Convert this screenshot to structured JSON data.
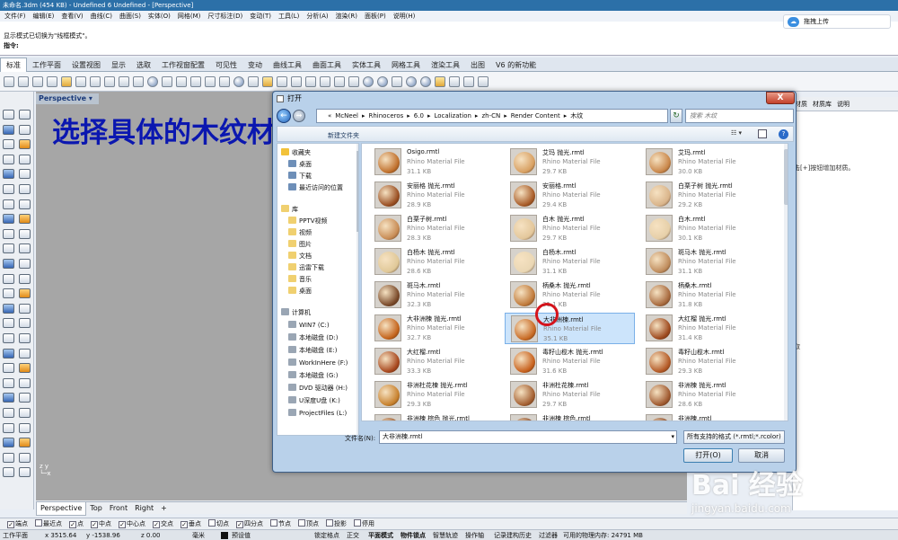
{
  "window": {
    "title": "未命名.3dm (454 KB) - Undefined 6 Undefined - [Perspective]"
  },
  "menu": [
    "文件(F)",
    "编辑(E)",
    "查看(V)",
    "曲线(C)",
    "曲面(S)",
    "实体(O)",
    "网格(M)",
    "尺寸标注(D)",
    "变动(T)",
    "工具(L)",
    "分析(A)",
    "渲染(R)",
    "面板(P)",
    "说明(H)"
  ],
  "cloud_button": {
    "label": "拖拽上传"
  },
  "command": {
    "line1": "显示模式已切换为\"线框模式\"。",
    "prompt": "指令:"
  },
  "tabs": [
    "标准",
    "工作平面",
    "设置视图",
    "显示",
    "选取",
    "工作视窗配置",
    "可见性",
    "变动",
    "曲线工具",
    "曲面工具",
    "实体工具",
    "网格工具",
    "渲染工具",
    "出图",
    "V6 的新功能"
  ],
  "viewport": {
    "label": "Perspective ▾",
    "tabs": [
      "Perspective",
      "Top",
      "Front",
      "Right",
      "+"
    ]
  },
  "caption": "选择具体的木纹材质",
  "right_panel": {
    "tabs": [
      "材质",
      "材质库",
      "说明"
    ],
    "hint": "击[+]按钮增加材质。",
    "line2": "取"
  },
  "dialog": {
    "title": "打开",
    "back": "←",
    "forward": "→",
    "close": "X",
    "breadcrumb": [
      "«",
      "McNeel",
      "▸",
      "Rhinoceros",
      "▸",
      "6.0",
      "▸",
      "Localization",
      "▸",
      "zh-CN",
      "▸",
      "Render Content",
      "▸",
      "木纹"
    ],
    "search_placeholder": "搜索 木纹",
    "new_folder": "新建文件夹",
    "nav": {
      "favorites_header": "收藏夹",
      "favorites": [
        "桌面",
        "下载",
        "最近访问的位置"
      ],
      "library_header": "库",
      "libraries": [
        "PPTV视频",
        "视频",
        "图片",
        "文档",
        "迅雷下载",
        "音乐",
        "桌面"
      ],
      "computer_header": "计算机",
      "drives": [
        "WIN7 (C:)",
        "本地磁盘 (D:)",
        "本地磁盘 (E:)",
        "WorkInHere (F:)",
        "本地磁盘 (G:)",
        "DVD 驱动器 (H:)",
        "U深度U盘 (K:)",
        "ProjectFiles (L:)"
      ]
    },
    "files": [
      {
        "name": "Osigo.rmtl",
        "type": "Rhino Material File",
        "size": "31.1 KB"
      },
      {
        "name": "艾玛 抛光.rmtl",
        "type": "Rhino Material File",
        "size": "29.7 KB"
      },
      {
        "name": "艾玛.rmtl",
        "type": "Rhino Material File",
        "size": "30.0 KB"
      },
      {
        "name": "安丽格 抛光.rmtl",
        "type": "Rhino Material File",
        "size": "28.9 KB"
      },
      {
        "name": "安丽格.rmtl",
        "type": "Rhino Material File",
        "size": "29.4 KB"
      },
      {
        "name": "白栗子树 抛光.rmtl",
        "type": "Rhino Material File",
        "size": "29.2 KB"
      },
      {
        "name": "白栗子树.rmtl",
        "type": "Rhino Material File",
        "size": "28.3 KB"
      },
      {
        "name": "白木 抛光.rmtl",
        "type": "Rhino Material File",
        "size": "29.7 KB"
      },
      {
        "name": "白木.rmtl",
        "type": "Rhino Material File",
        "size": "30.1 KB"
      },
      {
        "name": "白杨木 抛光.rmtl",
        "type": "Rhino Material File",
        "size": "28.6 KB"
      },
      {
        "name": "白杨木.rmtl",
        "type": "Rhino Material File",
        "size": "31.1 KB"
      },
      {
        "name": "斑马木 抛光.rmtl",
        "type": "Rhino Material File",
        "size": "31.1 KB"
      },
      {
        "name": "斑马木.rmtl",
        "type": "Rhino Material File",
        "size": "32.3 KB"
      },
      {
        "name": "柄桑木 抛光.rmtl",
        "type": "Rhino Material File",
        "size": "31.1 KB"
      },
      {
        "name": "柄桑木.rmtl",
        "type": "Rhino Material File",
        "size": "31.8 KB"
      },
      {
        "name": "大非洲楝 抛光.rmtl",
        "type": "Rhino Material File",
        "size": "32.7 KB"
      },
      {
        "name": "大非洲楝.rmtl",
        "type": "Rhino Material File",
        "size": "35.1 KB"
      },
      {
        "name": "大红榴 抛光.rmtl",
        "type": "Rhino Material File",
        "size": "31.4 KB"
      },
      {
        "name": "大红榴.rmtl",
        "type": "Rhino Material File",
        "size": "33.3 KB"
      },
      {
        "name": "毒籽山榄木 抛光.rmtl",
        "type": "Rhino Material File",
        "size": "31.6 KB"
      },
      {
        "name": "毒籽山榄木.rmtl",
        "type": "Rhino Material File",
        "size": "29.3 KB"
      },
      {
        "name": "非洲杜花楝 抛光.rmtl",
        "type": "Rhino Material File",
        "size": "29.3 KB"
      },
      {
        "name": "非洲杜花楝.rmtl",
        "type": "Rhino Material File",
        "size": "29.7 KB"
      },
      {
        "name": "非洲楝 抛光.rmtl",
        "type": "Rhino Material File",
        "size": "28.6 KB"
      },
      {
        "name": "非洲楝 棕色 抛光.rmtl",
        "type": "",
        "size": ""
      },
      {
        "name": "非洲楝 棕色.rmtl",
        "type": "",
        "size": ""
      },
      {
        "name": "非洲楝.rmtl",
        "type": "",
        "size": ""
      }
    ],
    "selected_index": 16,
    "filename_label": "文件名(N):",
    "filename_value": "大非洲楝.rmtl",
    "filetype_value": "所有支持的格式 (*.rmtl;*.rcolor)",
    "open_label": "打开(O)",
    "cancel_label": "取消"
  },
  "osnap": [
    "端点",
    "最近点",
    "点",
    "中点",
    "中心点",
    "交点",
    "垂点",
    "切点",
    "四分点",
    "节点",
    "顶点",
    "投影",
    "停用"
  ],
  "osnap_checked": [
    true,
    false,
    true,
    true,
    true,
    true,
    true,
    false,
    true,
    false,
    false,
    false,
    false
  ],
  "status": {
    "cplane": "工作平面",
    "x": "x 3515.64",
    "y": "y -1538.96",
    "z": "z 0.00",
    "unit": "毫米",
    "layer": "预设值",
    "btn_lock": "锁定格点",
    "btn_ortho": "正交",
    "btn_planar": "平面模式",
    "btn_osnap": "物件锁点",
    "btn_smart": "智慧轨迹",
    "btn_gumball": "操作轴",
    "btn_history": "记录建构历史",
    "btn_filter": "过滤器",
    "memory": "可用的物理内存: 24791 MB"
  },
  "watermark": {
    "logo": "Bai 经验",
    "url": "jingyan.baidu.com"
  }
}
